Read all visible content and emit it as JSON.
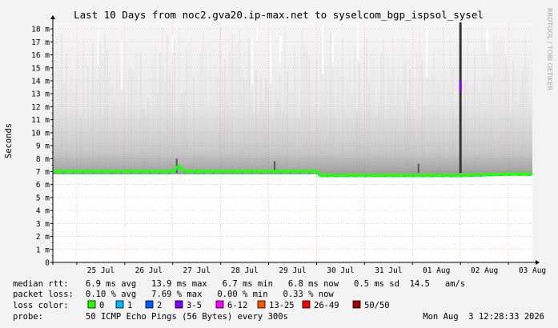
{
  "chart_data": {
    "type": "line",
    "title": "Last 10 Days from noc2.gva20.ip-max.net to syselcom_bgp_ispsol_sysel",
    "ylabel": "Seconds",
    "side_label": "RRDTOOL / TOBI OETIKER",
    "ylim": [
      0,
      18.5
    ],
    "y_ticks": [
      "0",
      "1 m",
      "2 m",
      "3 m",
      "4 m",
      "5 m",
      "6 m",
      "7 m",
      "8 m",
      "9 m",
      "10 m",
      "11 m",
      "12 m",
      "13 m",
      "14 m",
      "15 m",
      "16 m",
      "17 m",
      "18 m"
    ],
    "x_range": [
      "2026-07-24 12:00",
      "2026-08-03 12:00"
    ],
    "x_ticks": [
      "25 Jul",
      "26 Jul",
      "27 Jul",
      "28 Jul",
      "29 Jul",
      "30 Jul",
      "31 Jul",
      "01 Aug",
      "02 Aug",
      "03 Aug"
    ],
    "grid": true,
    "series": [
      {
        "kind": "median",
        "x": [
          "2026-07-24 12:00",
          "2026-07-25 12:00",
          "2026-07-26 12:00",
          "2026-07-27 00:00",
          "2026-07-27 03:00",
          "2026-07-27 06:00",
          "2026-07-28 00:00",
          "2026-07-29 00:00",
          "2026-07-30 00:00",
          "2026-07-30 02:00",
          "2026-07-31 00:00",
          "2026-08-01 00:00",
          "2026-08-02 00:00",
          "2026-08-03 00:00",
          "2026-08-03 12:00"
        ],
        "y": [
          7.0,
          7.0,
          7.0,
          7.0,
          7.4,
          7.0,
          7.0,
          7.0,
          7.0,
          6.7,
          6.7,
          6.7,
          6.7,
          6.8,
          6.8
        ]
      }
    ],
    "spikes": [
      {
        "x": "2026-07-27 02:00",
        "y": 8.0
      },
      {
        "x": "2026-07-29 03:00",
        "y": 7.8
      },
      {
        "x": "2026-08-01 03:00",
        "y": 7.6
      },
      {
        "x": "2026-08-02 00:00",
        "y": 18.5
      }
    ],
    "legend_colors": [
      {
        "label": "0",
        "color": "#26ff00"
      },
      {
        "label": "1",
        "color": "#00b8ff"
      },
      {
        "label": "2",
        "color": "#0059ff"
      },
      {
        "label": "3-5",
        "color": "#7e00ff"
      },
      {
        "label": "6-12",
        "color": "#ff00ff"
      },
      {
        "label": "13-25",
        "color": "#ff5500"
      },
      {
        "label": "26-49",
        "color": "#ff0000"
      },
      {
        "label": "50/50",
        "color": "#a10000"
      }
    ]
  },
  "stats": {
    "rtt_label": "median rtt:",
    "rtt_values": "6.9 ms avg   13.9 ms max   6.7 ms min   6.8 ms now   0.5 ms sd  14.5   am/s",
    "loss_label": "packet loss:",
    "loss_values": "0.10 % avg   7.69 % max   0.00 % min   0.33 % now",
    "color_label": "loss color:",
    "probe_label": "probe:",
    "probe_values": "50 ICMP Echo Pings (56 Bytes) every 300s",
    "timestamp": "Mon Aug  3 12:28:33 2026"
  }
}
